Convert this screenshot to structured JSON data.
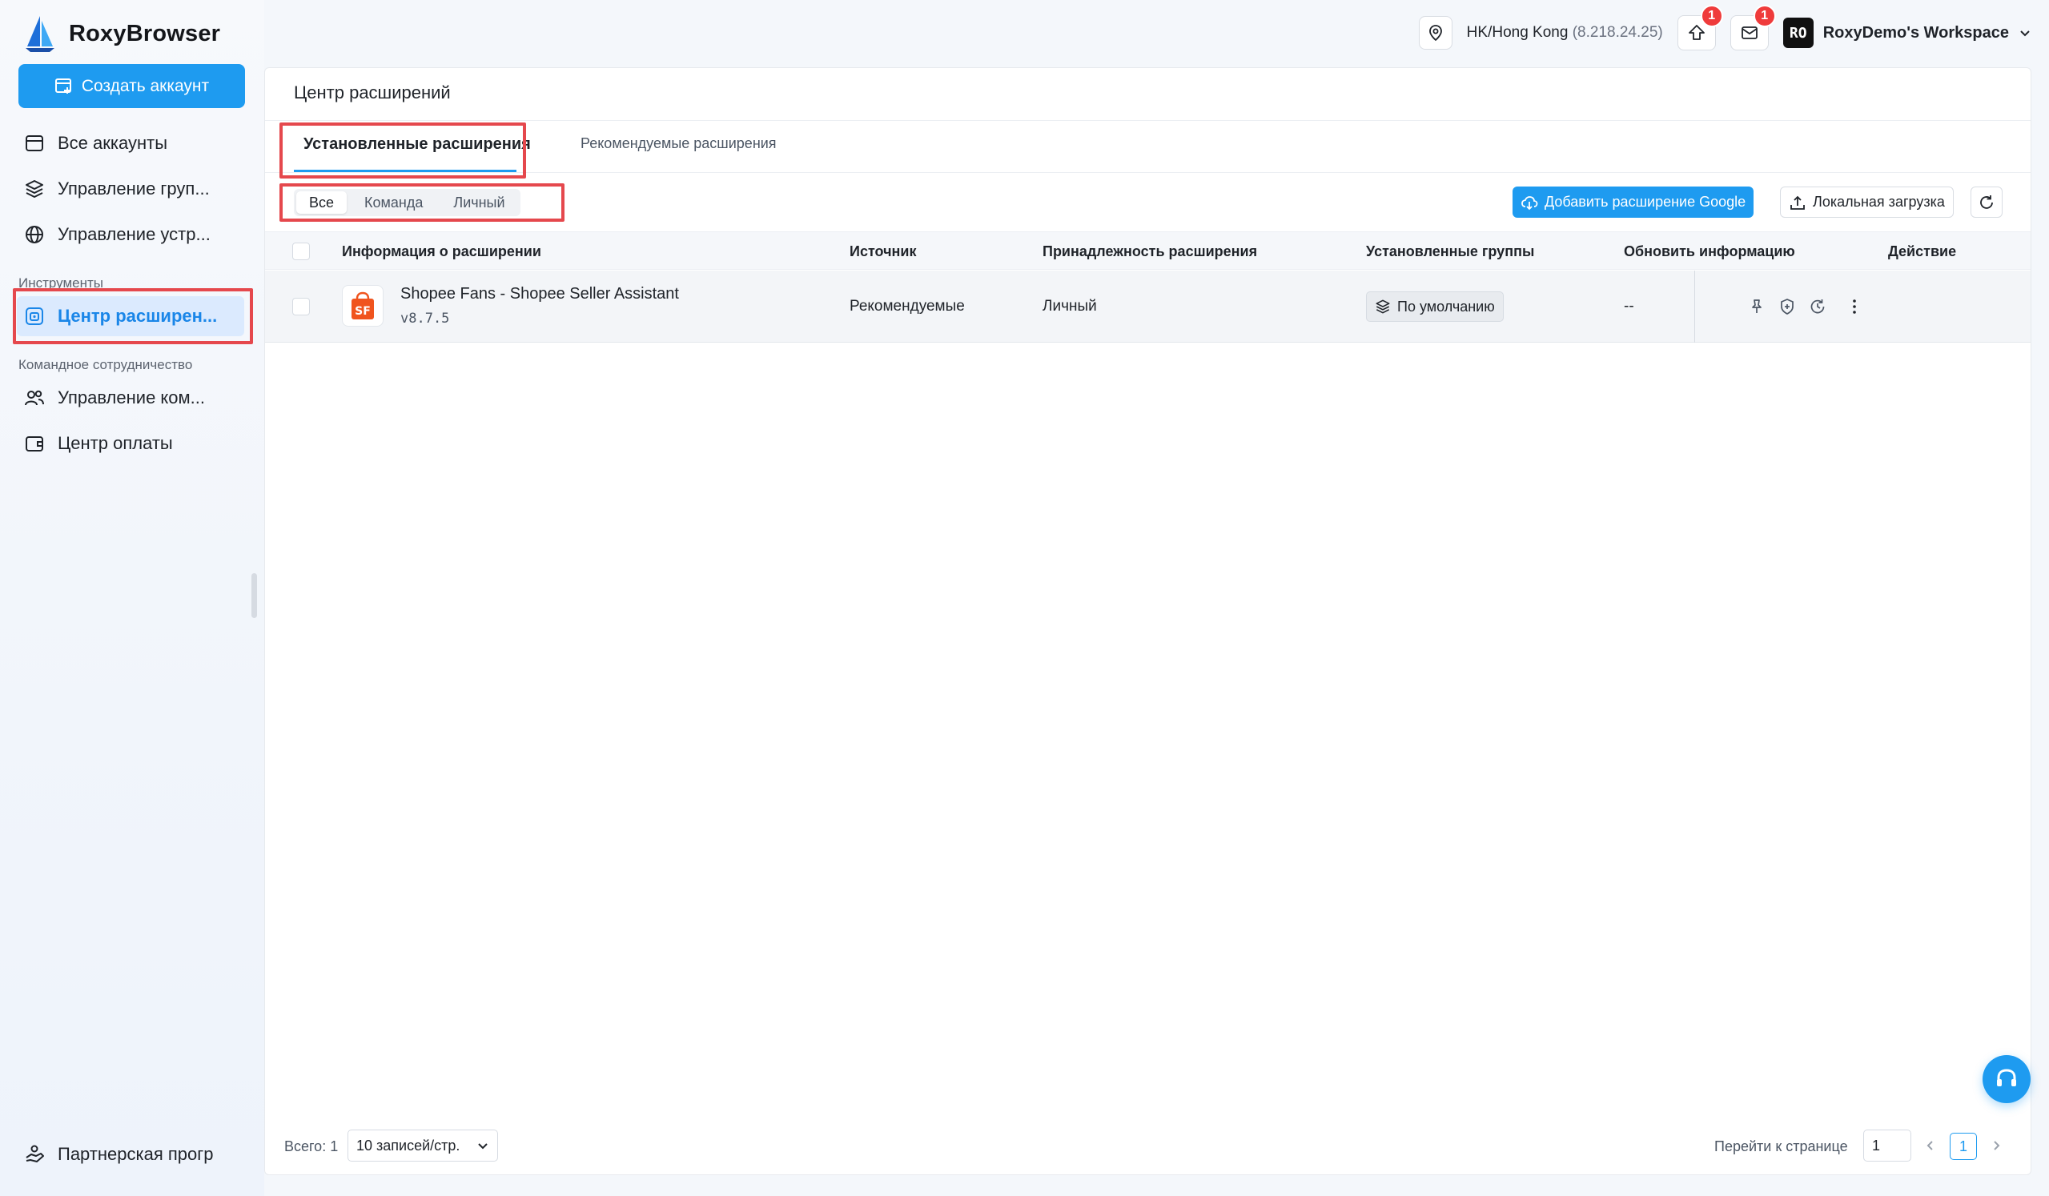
{
  "app": {
    "name": "RoxyBrowser"
  },
  "sidebar": {
    "create_label": "Создать аккаунт",
    "items": [
      {
        "label": "Все аккаунты",
        "icon": "browser-window-icon"
      },
      {
        "label": "Управление груп...",
        "icon": "layers-icon"
      },
      {
        "label": "Управление устр...",
        "icon": "globe-icon"
      }
    ],
    "section_tools": "Инструменты",
    "active_item": {
      "label": "Центр расширен...",
      "icon": "extension-center-icon"
    },
    "section_team": "Командное сотрудничество",
    "team_items": [
      {
        "label": "Управление ком...",
        "icon": "users-icon"
      },
      {
        "label": "Центр оплаты",
        "icon": "wallet-icon"
      }
    ],
    "partner_label": "Партнерская прогр"
  },
  "topbar": {
    "location": "HK/Hong Kong",
    "ip": "(8.218.24.25)",
    "update_badge": "1",
    "mail_badge": "1",
    "workspace_avatar": "RO",
    "workspace_name": "RoxyDemo's Workspace"
  },
  "page": {
    "title": "Центр расширений",
    "tabs": [
      "Установленные расширения",
      "Рекомендуемые расширения"
    ],
    "filters": [
      "Все",
      "Команда",
      "Личный"
    ],
    "add_google_label": "Добавить расширение Google",
    "local_upload_label": "Локальная загрузка"
  },
  "table": {
    "columns": [
      "Информация о расширении",
      "Источник",
      "Принадлежность расширения",
      "Установленные группы",
      "Обновить информацию",
      "Действие"
    ],
    "rows": [
      {
        "name": "Shopee Fans - Shopee Seller Assistant",
        "version": "v8.7.5",
        "source": "Рекомендуемые",
        "ownership": "Личный",
        "group": "По умолчанию",
        "update_info": "--",
        "logo_text": "SF"
      }
    ]
  },
  "pagination": {
    "total": "Всего: 1",
    "page_size": "10 записей/стр.",
    "goto_label": "Перейти к странице",
    "goto_value": "1",
    "current_page": "1"
  },
  "colors": {
    "accent": "#1e9bf0",
    "highlight_box": "#e5484d",
    "badge": "#ef3b3b"
  }
}
